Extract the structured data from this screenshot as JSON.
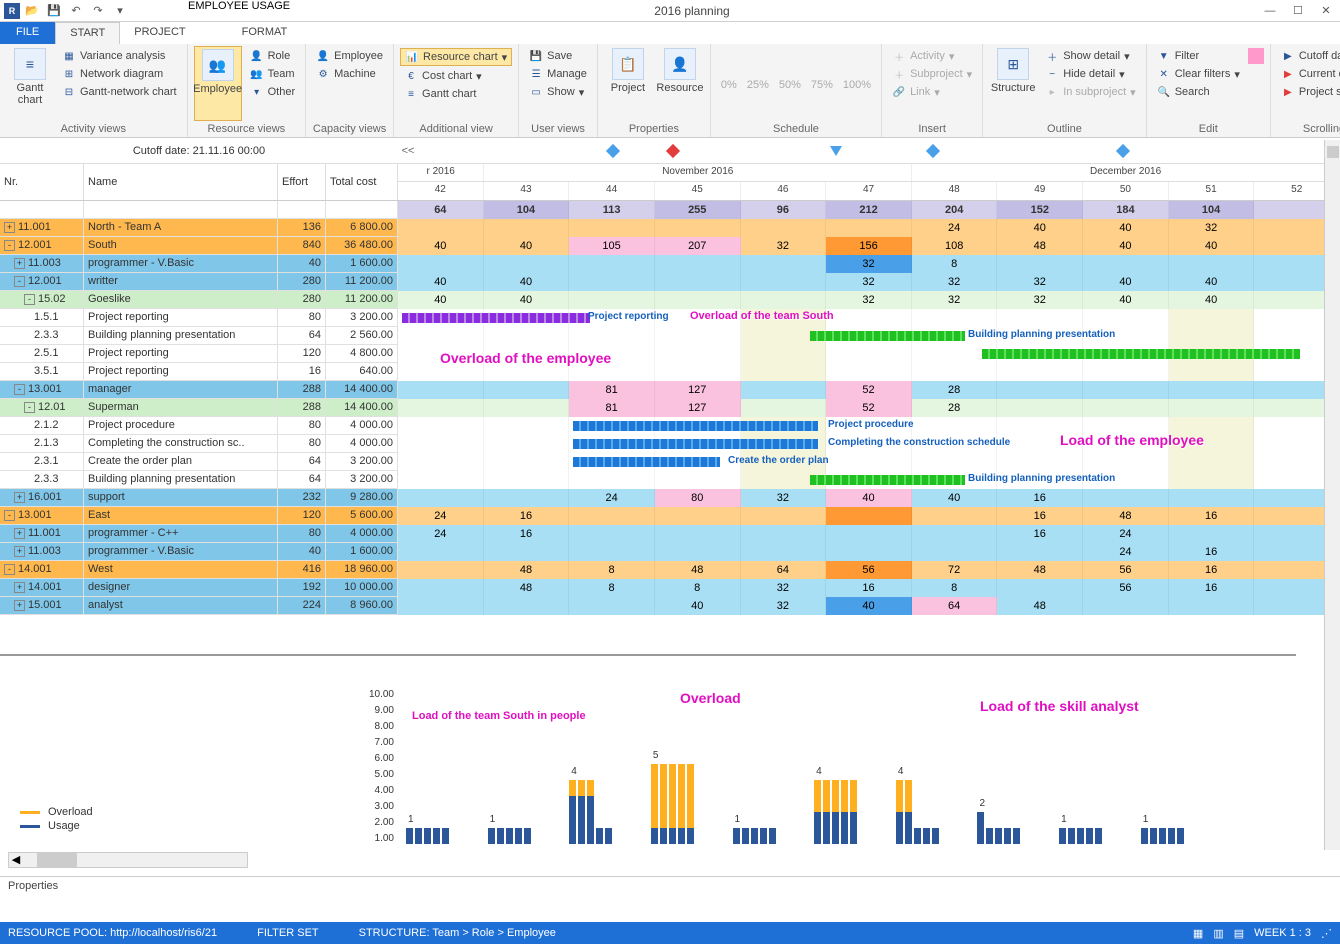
{
  "title": "2016 planning",
  "qat_icons": [
    "folder",
    "save",
    "undo",
    "redo"
  ],
  "tabs": {
    "file": "FILE",
    "start": "START",
    "project": "PROJECT",
    "context_group": "EMPLOYEE USAGE",
    "format": "FORMAT"
  },
  "ribbon": {
    "activity": {
      "gantt": "Gantt chart",
      "variance": "Variance analysis",
      "network": "Network diagram",
      "gnc": "Gantt-network chart",
      "label": "Activity views"
    },
    "resource": {
      "employee": "Employee",
      "role": "Role",
      "team": "Team",
      "other": "Other",
      "label": "Resource views"
    },
    "capacity": {
      "employee": "Employee",
      "machine": "Machine",
      "label": "Capacity views"
    },
    "additional": {
      "resource": "Resource chart",
      "cost": "Cost chart",
      "gantt": "Gantt chart",
      "label": "Additional view"
    },
    "user": {
      "save": "Save",
      "manage": "Manage",
      "show": "Show",
      "label": "User views"
    },
    "properties": {
      "project": "Project",
      "resource": "Resource",
      "label": "Properties"
    },
    "schedule": {
      "p0": "0%",
      "p25": "25%",
      "p50": "50%",
      "p75": "75%",
      "p100": "100%",
      "label": "Schedule"
    },
    "insert": {
      "activity": "Activity",
      "subproject": "Subproject",
      "link": "Link",
      "label": "Insert"
    },
    "outline": {
      "structure": "Structure",
      "showd": "Show detail",
      "hided": "Hide detail",
      "insub": "In subproject",
      "label": "Outline"
    },
    "edit": {
      "filter": "Filter",
      "clear": "Clear filters",
      "search": "Search",
      "label": "Edit"
    },
    "scrolling": {
      "cutoff": "Cutoff date",
      "current": "Current date",
      "pstart": "Project start",
      "label": "Scrolling"
    }
  },
  "cutoff": "Cutoff date: 21.11.16 00:00",
  "timescale_back": "<<",
  "months": [
    {
      "label": "r 2016",
      "span": 1
    },
    {
      "label": "November 2016",
      "span": 5
    },
    {
      "label": "December 2016",
      "span": 5
    }
  ],
  "weeks": [
    "42",
    "43",
    "44",
    "45",
    "46",
    "47",
    "48",
    "49",
    "50",
    "51",
    "52"
  ],
  "headers": {
    "nr": "Nr.",
    "name": "Name",
    "effort": "Effort",
    "cost": "Total cost"
  },
  "sumrow": [
    "64",
    "104",
    "113",
    "255",
    "96",
    "212",
    "204",
    "152",
    "184",
    "104",
    ""
  ],
  "rows": [
    {
      "style": "orange",
      "toggle": "+",
      "indent": 0,
      "nr": "11.001",
      "name": "North - Team A",
      "eff": "136",
      "cost": "6 800.00",
      "vals": [
        "",
        "",
        "",
        "",
        "",
        "",
        "24",
        "40",
        "40",
        "32",
        ""
      ]
    },
    {
      "style": "orange",
      "toggle": "-",
      "indent": 0,
      "nr": "12.001",
      "name": "South",
      "eff": "840",
      "cost": "36 480.00",
      "vals": [
        "40",
        "40",
        "105",
        "207",
        "32",
        "156",
        "108",
        "48",
        "40",
        "40",
        ""
      ],
      "hl": {
        "2": "pink",
        "3": "pink",
        "5": "orangehl"
      }
    },
    {
      "style": "blue",
      "toggle": "+",
      "indent": 1,
      "nr": "11.003",
      "name": "programmer - V.Basic",
      "eff": "40",
      "cost": "1 600.00",
      "vals": [
        "",
        "",
        "",
        "",
        "",
        "32",
        "8",
        "",
        "",
        "",
        ""
      ],
      "hl": {
        "5": "bluehl"
      }
    },
    {
      "style": "blue",
      "toggle": "-",
      "indent": 1,
      "nr": "12.001",
      "name": "writter",
      "eff": "280",
      "cost": "11 200.00",
      "vals": [
        "40",
        "40",
        "",
        "",
        "",
        "32",
        "32",
        "32",
        "40",
        "40",
        ""
      ]
    },
    {
      "style": "green",
      "toggle": "-",
      "indent": 2,
      "nr": "15.02",
      "name": "Goeslike",
      "eff": "280",
      "cost": "11 200.00",
      "vals": [
        "40",
        "40",
        "",
        "",
        "",
        "32",
        "32",
        "32",
        "40",
        "40",
        ""
      ]
    },
    {
      "style": "white",
      "indent": 3,
      "nr": "1.5.1",
      "name": "Project reporting",
      "eff": "80",
      "cost": "3 200.00",
      "bar": {
        "color": "purple",
        "from": 0,
        "to": 2.3,
        "label": "Project reporting",
        "labelx": 190
      }
    },
    {
      "style": "white",
      "indent": 3,
      "nr": "2.3.3",
      "name": "Building planning presentation",
      "eff": "64",
      "cost": "2 560.00",
      "bar": {
        "color": "green",
        "from": 5,
        "to": 6.9,
        "label": "Building planning presentation",
        "labelx": 570
      }
    },
    {
      "style": "white",
      "indent": 3,
      "nr": "2.5.1",
      "name": "Project reporting",
      "eff": "120",
      "cost": "4 800.00",
      "bar": {
        "color": "green",
        "from": 7.1,
        "to": 11,
        "label": "",
        "labelx": 0
      }
    },
    {
      "style": "white",
      "indent": 3,
      "nr": "3.5.1",
      "name": "Project reporting",
      "eff": "16",
      "cost": "640.00"
    },
    {
      "style": "blue",
      "toggle": "-",
      "indent": 1,
      "nr": "13.001",
      "name": "manager",
      "eff": "288",
      "cost": "14 400.00",
      "vals": [
        "",
        "",
        "81",
        "127",
        "",
        "52",
        "28",
        "",
        "",
        "",
        ""
      ],
      "hl": {
        "2": "pink",
        "3": "pink",
        "5": "pink"
      }
    },
    {
      "style": "green",
      "toggle": "-",
      "indent": 2,
      "nr": "12.01",
      "name": "Superman",
      "eff": "288",
      "cost": "14 400.00",
      "vals": [
        "",
        "",
        "81",
        "127",
        "",
        "52",
        "28",
        "",
        "",
        "",
        ""
      ],
      "hl": {
        "2": "pink",
        "3": "pink",
        "5": "pink"
      }
    },
    {
      "style": "white",
      "indent": 3,
      "nr": "2.1.2",
      "name": "Project procedure",
      "eff": "80",
      "cost": "4 000.00",
      "bar": {
        "color": "blue",
        "from": 2.1,
        "to": 5.1,
        "label": "Project procedure",
        "labelx": 430
      }
    },
    {
      "style": "white",
      "indent": 3,
      "nr": "2.1.3",
      "name": "Completing the construction sc..",
      "eff": "80",
      "cost": "4 000.00",
      "bar": {
        "color": "blue",
        "from": 2.1,
        "to": 5.1,
        "label": "Completing the construction schedule",
        "labelx": 430
      }
    },
    {
      "style": "white",
      "indent": 3,
      "nr": "2.3.1",
      "name": "Create the order plan",
      "eff": "64",
      "cost": "3 200.00",
      "bar": {
        "color": "blue",
        "from": 2.1,
        "to": 3.9,
        "label": "Create the order plan",
        "labelx": 330
      }
    },
    {
      "style": "white",
      "indent": 3,
      "nr": "2.3.3",
      "name": "Building planning presentation",
      "eff": "64",
      "cost": "3 200.00",
      "bar": {
        "color": "green",
        "from": 5,
        "to": 6.9,
        "label": "Building planning presentation",
        "labelx": 570
      }
    },
    {
      "style": "blue",
      "toggle": "+",
      "indent": 1,
      "nr": "16.001",
      "name": "support",
      "eff": "232",
      "cost": "9 280.00",
      "vals": [
        "",
        "",
        "24",
        "80",
        "32",
        "40",
        "40",
        "16",
        "",
        "",
        ""
      ],
      "hl": {
        "3": "pink",
        "5": "pink"
      }
    },
    {
      "style": "orange",
      "toggle": "-",
      "indent": 0,
      "nr": "13.001",
      "name": "East",
      "eff": "120",
      "cost": "5 600.00",
      "vals": [
        "24",
        "16",
        "",
        "",
        "",
        "",
        "",
        "16",
        "48",
        "16",
        ""
      ],
      "hl": {
        "5": "orangehl"
      }
    },
    {
      "style": "blue",
      "toggle": "+",
      "indent": 1,
      "nr": "11.001",
      "name": "programmer - C++",
      "eff": "80",
      "cost": "4 000.00",
      "vals": [
        "24",
        "16",
        "",
        "",
        "",
        "",
        "",
        "16",
        "24",
        "",
        ""
      ]
    },
    {
      "style": "blue",
      "toggle": "+",
      "indent": 1,
      "nr": "11.003",
      "name": "programmer - V.Basic",
      "eff": "40",
      "cost": "1 600.00",
      "vals": [
        "",
        "",
        "",
        "",
        "",
        "",
        "",
        "",
        "24",
        "16",
        ""
      ]
    },
    {
      "style": "orange",
      "toggle": "-",
      "indent": 0,
      "nr": "14.001",
      "name": "West",
      "eff": "416",
      "cost": "18 960.00",
      "vals": [
        "",
        "48",
        "8",
        "48",
        "64",
        "56",
        "72",
        "48",
        "56",
        "16",
        ""
      ],
      "hl": {
        "5": "orangehl"
      }
    },
    {
      "style": "blue",
      "toggle": "+",
      "indent": 1,
      "nr": "14.001",
      "name": "designer",
      "eff": "192",
      "cost": "10 000.00",
      "vals": [
        "",
        "48",
        "8",
        "8",
        "32",
        "16",
        "8",
        "",
        "56",
        "16",
        ""
      ]
    },
    {
      "style": "blue",
      "toggle": "+",
      "indent": 1,
      "nr": "15.001",
      "name": "analyst",
      "eff": "224",
      "cost": "8 960.00",
      "vals": [
        "",
        "",
        "",
        "40",
        "32",
        "40",
        "64",
        "48",
        "",
        "",
        ""
      ],
      "hl": {
        "5": "bluehl",
        "6": "pink"
      }
    }
  ],
  "annotations": {
    "overload_south": "Overload of the team South",
    "overload_emp": "Overload of the employee",
    "load_emp": "Load of the employee",
    "load_south": "Load of the team South in people",
    "overload": "Overload",
    "load_analyst": "Load of the skill analyst"
  },
  "chart_data": {
    "type": "bar",
    "ylabel": "",
    "ylim": [
      0,
      10
    ],
    "yticks": [
      "1.00",
      "2.00",
      "3.00",
      "4.00",
      "5.00",
      "6.00",
      "7.00",
      "8.00",
      "9.00",
      "10.00"
    ],
    "legend": {
      "overload": "Overload",
      "usage": "Usage"
    },
    "clusters": [
      {
        "x": 0,
        "label": "1",
        "bars": [
          1,
          1,
          1,
          1,
          1
        ]
      },
      {
        "x": 1,
        "label": "1",
        "bars": [
          1,
          1,
          1,
          1,
          1
        ]
      },
      {
        "x": 2,
        "label": "4",
        "bars": [
          4,
          4,
          4,
          1,
          1
        ],
        "overload": [
          1,
          1,
          1,
          0,
          0
        ]
      },
      {
        "x": 3,
        "label": "5",
        "bars": [
          5,
          5,
          5,
          5,
          5
        ],
        "overload": [
          4,
          4,
          4,
          4,
          4
        ]
      },
      {
        "x": 4,
        "label": "1",
        "bars": [
          1,
          1,
          1,
          1,
          1
        ]
      },
      {
        "x": 5,
        "label": "4",
        "bars": [
          4,
          4,
          4,
          4,
          4
        ],
        "overload": [
          2,
          2,
          2,
          2,
          2
        ]
      },
      {
        "x": 6,
        "label": "4",
        "bars": [
          4,
          4,
          1,
          1,
          1
        ],
        "overload": [
          2,
          2,
          0,
          0,
          0
        ]
      },
      {
        "x": 7,
        "label": "2",
        "bars": [
          2,
          1,
          1,
          1,
          1
        ]
      },
      {
        "x": 8,
        "label": "1",
        "bars": [
          1,
          1,
          1,
          1,
          1
        ]
      },
      {
        "x": 9,
        "label": "1",
        "bars": [
          1,
          1,
          1,
          1,
          1
        ]
      }
    ]
  },
  "properties_label": "Properties",
  "status": {
    "pool": "RESOURCE POOL: http://localhost/ris6/21",
    "filter": "FILTER SET",
    "structure": "STRUCTURE: Team > Role > Employee",
    "week": "WEEK 1 : 3"
  }
}
